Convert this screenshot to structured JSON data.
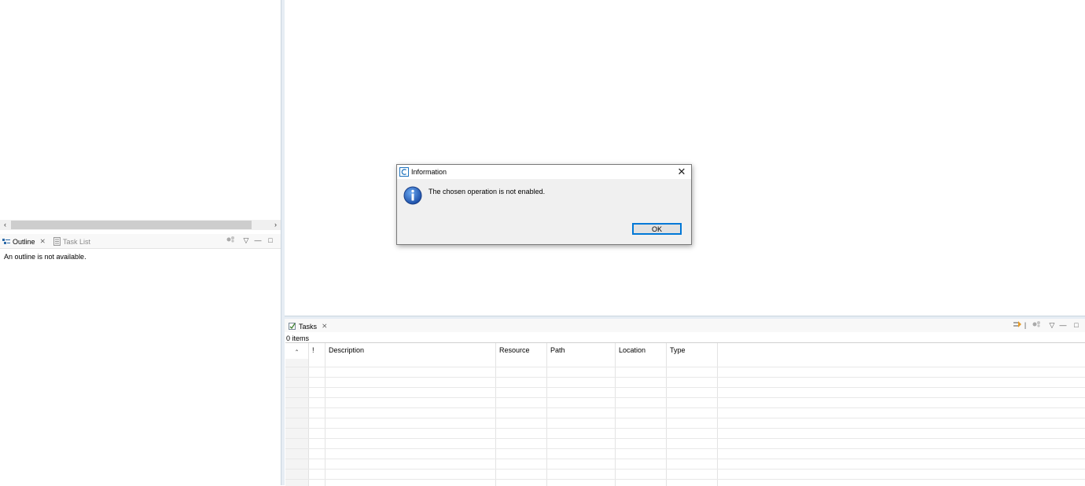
{
  "outline_view": {
    "tabs": [
      {
        "label": "Outline",
        "icon": "outline-icon",
        "active": true
      },
      {
        "label": "Task List",
        "icon": "task-list-icon",
        "active": false
      }
    ],
    "message": "An outline is not available."
  },
  "tasks_view": {
    "tab_label": "Tasks",
    "item_count": "0 items",
    "columns": [
      "!",
      "Description",
      "Resource",
      "Path",
      "Location",
      "Type"
    ]
  },
  "dialog": {
    "title": "Information",
    "message": "The chosen operation is not enabled.",
    "ok_label": "OK",
    "icon": "information-icon",
    "accent": "#0078d7"
  }
}
